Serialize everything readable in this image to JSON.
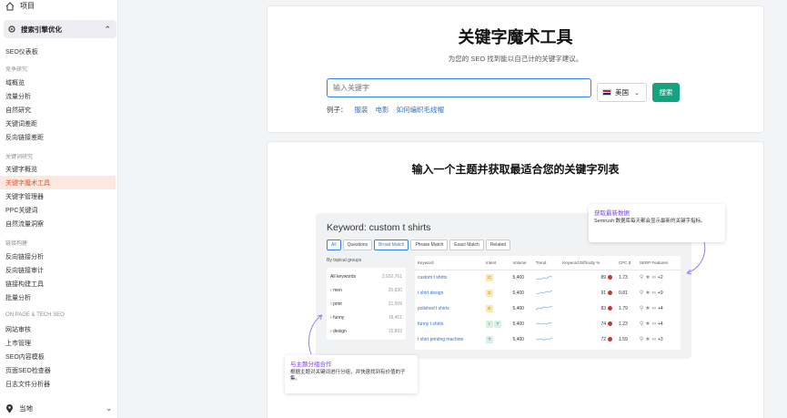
{
  "sidebar": {
    "home": "项目",
    "project": "搜索引擎优化",
    "overview": "SEO仪表板",
    "sections": [
      {
        "title": "竞争研究",
        "items": [
          "域概览",
          "流量分析",
          "自然研究",
          "关键词差距",
          "反向链接差距"
        ]
      },
      {
        "title": "关键词研究",
        "items": [
          "关键字概览",
          "关键字魔术工具",
          "关键字管理器",
          "PPC关键词",
          "自然流量洞察"
        ]
      },
      {
        "title": "链接构建",
        "items": [
          "反向链接分析",
          "反向链接审计",
          "链接构建工具",
          "批量分析"
        ]
      },
      {
        "title": "ON PAGE & TECH SEO",
        "items": [
          "网站审核",
          "上市管理",
          "SEO内容模板",
          "页面SEO检查器",
          "日志文件分析器"
        ]
      }
    ],
    "bottom": "当地"
  },
  "search_card": {
    "title": "关键字魔术工具",
    "subtitle": "为您的 SEO 找到能以自己计的关键字建议。",
    "input_placeholder": "输入关键字",
    "country": "美国",
    "search_button": "搜索",
    "examples_label": "例子：",
    "examples": [
      "服装",
      "电影",
      "如何编织毛线帽"
    ]
  },
  "promo": {
    "title": "输入一个主题并获取最适合您的关键字列表",
    "preview": {
      "title": "Keyword: custom t shirts",
      "tabs": [
        "All",
        "Questions",
        "Broad Match",
        "Phrase Match",
        "Exact Match",
        "Related"
      ],
      "groups_header": "By topical groups",
      "groups": [
        {
          "name": "All keywords",
          "count": "2,932,761"
        },
        {
          "name": "men",
          "count": "25,830"
        },
        {
          "name": "print",
          "count": "21,509"
        },
        {
          "name": "funny",
          "count": "18,451"
        },
        {
          "name": "design",
          "count": "15,892"
        }
      ],
      "columns": [
        "Keyword",
        "Intent",
        "Volume",
        "Trend",
        "Keyword Difficulty %",
        "CPC $",
        "SERP Features"
      ],
      "rows": [
        {
          "keyword": "custom t shirts",
          "intents": [
            "C"
          ],
          "volume": "5,400",
          "kd": "89",
          "cpc": "1.73",
          "sf": "+2"
        },
        {
          "keyword": "t shirt design",
          "intents": [
            "C"
          ],
          "volume": "5,400",
          "kd": "91",
          "cpc": "0.81",
          "sf": "+9"
        },
        {
          "keyword": "polished t shirts",
          "intents": [
            "C"
          ],
          "volume": "5,400",
          "kd": "83",
          "cpc": "1.79",
          "sf": "+4"
        },
        {
          "keyword": "funny t shirts",
          "intents": [
            "I",
            "T"
          ],
          "volume": "5,400",
          "kd": "74",
          "cpc": "1.23",
          "sf": "+4"
        },
        {
          "keyword": "t shirt printing machine",
          "intents": [
            "T"
          ],
          "volume": "5,400",
          "kd": "72",
          "cpc": "1.59",
          "sf": "+3"
        }
      ]
    },
    "callout_top": {
      "title": "获取最新数据",
      "desc": "Semrush 数据库每天都会显示最新的关键字指标。"
    },
    "callout_bottom": {
      "title": "与主题分组合作",
      "desc": "根据主题对关键词进行分组，并快速找到有价值的子集。"
    }
  },
  "colors": {
    "accent": "#e0542a",
    "search_border": "#2f80ed",
    "search_button": "#14a37f",
    "callout_title": "#7b3fe4"
  }
}
